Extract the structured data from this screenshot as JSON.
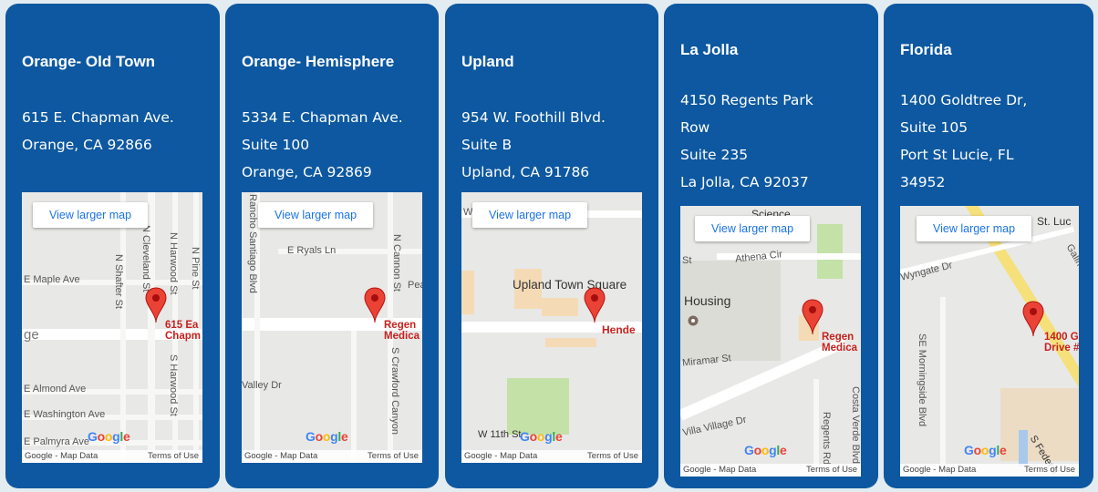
{
  "locations": [
    {
      "name": "Orange- Old Town",
      "address": [
        "615 E. Chapman Ave.",
        "Orange, CA 92866"
      ],
      "map": {
        "view_larger": "View larger map",
        "place_label": [
          "615 Ea",
          "Chapm"
        ],
        "streets": [
          "E Maple Ave",
          "N Shafter St",
          "N Cleveland St",
          "N Harwood St",
          "S Harwood St",
          "N Pine St",
          "ge",
          "E Almond Ave",
          "E Washington Ave",
          "E Palmyra Ave"
        ],
        "attribution": "Google - Map Data",
        "terms": "Terms of Use"
      }
    },
    {
      "name": "Orange- Hemisphere",
      "address": [
        "5334 E. Chapman Ave.",
        "Suite 100",
        "Orange, CA 92869"
      ],
      "map": {
        "view_larger": "View larger map",
        "place_label": [
          "Regen",
          "Medica"
        ],
        "streets": [
          "Rancho Santiago Blvd",
          "E Ryals Ln",
          "N Cannon St",
          "Pea",
          "S Crawford Canyon",
          "Valley Dr"
        ],
        "attribution": "Google - Map Data",
        "terms": "Terms of Use"
      }
    },
    {
      "name": "Upland",
      "address": [
        "954 W. Foothill Blvd.",
        "Suite B",
        "Upland, CA 91786"
      ],
      "map": {
        "view_larger": "View larger map",
        "place_label": [
          "Hende"
        ],
        "streets": [
          "Upland Town Square",
          "W 11th St",
          "W"
        ],
        "attribution": "Google - Map Data",
        "terms": "Terms of Use"
      }
    },
    {
      "name": "La Jolla",
      "address": [
        "4150 Regents Park",
        "Row",
        "Suite 235",
        "La Jolla, CA 92037"
      ],
      "map": {
        "view_larger": "View larger map",
        "place_label": [
          "Regen",
          "Medica"
        ],
        "streets": [
          "Science",
          "Athena Cir",
          "St",
          "Housing",
          "Miramar St",
          "Villa Village Dr",
          "Regents Rd",
          "Costa Verde Blvd"
        ],
        "attribution": "Google - Map Data",
        "terms": "Terms of Use"
      }
    },
    {
      "name": "Florida",
      "address": [
        "1400 Goldtree Dr,",
        "Suite 105",
        "Port St Lucie, FL",
        "34952"
      ],
      "map": {
        "view_larger": "View larger map",
        "place_label": [
          "1400 G",
          "Drive #"
        ],
        "streets": [
          "St. Luc",
          "Wyngate Dr",
          "Gallmoor Dr",
          "SE Morningside Blvd",
          "S Federal"
        ],
        "attribution": "Google - Map Data",
        "terms": "Terms of Use"
      }
    }
  ]
}
